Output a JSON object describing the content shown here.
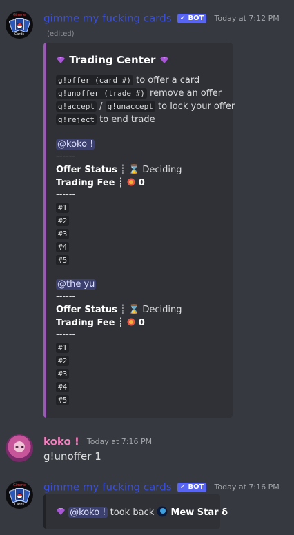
{
  "message1": {
    "username": "gimme my fucking cards",
    "badge": "✓ BOT",
    "timestamp": "Today at 7:12 PM",
    "edited": "(edited)",
    "avatar_top": "Gimme",
    "avatar_bottom": "Cards",
    "embed": {
      "accent": "#9b59b6",
      "title": "Trading Center",
      "commands": [
        {
          "code": "g!offer (card #)",
          "text": " to offer a card"
        },
        {
          "code": "g!unoffer (trade #)",
          "text": " remove an offer"
        },
        {
          "code": "g!accept",
          "sep": " / ",
          "code2": "g!unaccept",
          "text": " to lock your offer"
        },
        {
          "code": "g!reject",
          "text": " to end trade"
        }
      ],
      "players": [
        {
          "mention": "@koko !",
          "dashes": "------",
          "status_label": "Offer Status",
          "status_sep": " ┊ ",
          "status_value": "Deciding",
          "fee_label": "Trading Fee",
          "fee_sep": " ┊ ",
          "fee_value": "0",
          "dashes2": "------",
          "slots": [
            "#1",
            "#2",
            "#3",
            "#4",
            "#5"
          ]
        },
        {
          "mention": "@the yu",
          "dashes": "------",
          "status_label": "Offer Status",
          "status_sep": " ┊ ",
          "status_value": "Deciding",
          "fee_label": "Trading Fee",
          "fee_sep": " ┊ ",
          "fee_value": "0",
          "dashes2": "------",
          "slots": [
            "#1",
            "#2",
            "#3",
            "#4",
            "#5"
          ]
        }
      ]
    }
  },
  "message2": {
    "username": "koko !",
    "timestamp": "Today at 7:16 PM",
    "content": "g!unoffer 1"
  },
  "message3": {
    "username": "gimme my fucking cards",
    "badge": "✓ BOT",
    "timestamp": "Today at 7:16 PM",
    "avatar_top": "Gimme",
    "avatar_bottom": "Cards",
    "embed": {
      "accent": "#202225",
      "mention": "@koko !",
      "text": " took back ",
      "card_name": "Mew Star δ"
    }
  },
  "icons": [
    "gem-icon",
    "hourglass-icon",
    "coin-icon",
    "mew-icon",
    "bot-avatar",
    "user-avatar"
  ]
}
